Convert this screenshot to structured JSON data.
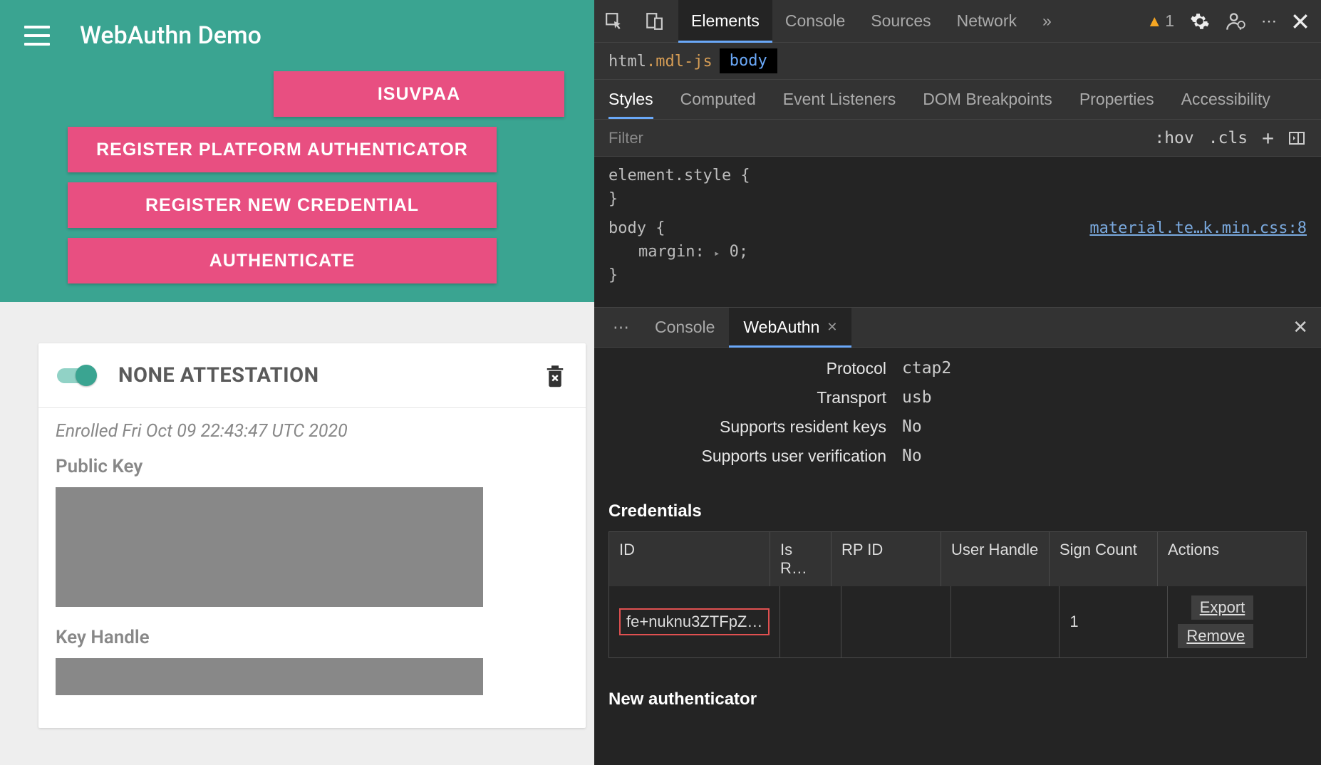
{
  "app": {
    "title": "WebAuthn Demo",
    "buttons": {
      "isuvpaa": "ISUVPAA",
      "reg_platform": "REGISTER PLATFORM AUTHENTICATOR",
      "reg_new": "REGISTER NEW CREDENTIAL",
      "auth": "AUTHENTICATE"
    },
    "card": {
      "title": "NONE ATTESTATION",
      "enrolled": "Enrolled Fri Oct 09 22:43:47 UTC 2020",
      "public_key_label": "Public Key",
      "key_handle_label": "Key Handle"
    }
  },
  "devtools": {
    "tabs": [
      "Elements",
      "Console",
      "Sources",
      "Network"
    ],
    "active_tab": "Elements",
    "warning_count": "1",
    "breadcrumb": {
      "html": "html",
      "class": ".mdl-js",
      "body": "body"
    },
    "styles_tabs": [
      "Styles",
      "Computed",
      "Event Listeners",
      "DOM Breakpoints",
      "Properties",
      "Accessibility"
    ],
    "active_styles_tab": "Styles",
    "filter_placeholder": "Filter",
    "filter_buttons": {
      "hov": ":hov",
      "cls": ".cls"
    },
    "css": {
      "element_style_open": "element.style {",
      "element_style_close": "}",
      "body_open": "body {",
      "body_prop": "margin: ▸ 0;",
      "body_prop_name": "margin",
      "body_prop_val": "0",
      "body_close": "}",
      "source_link": "material.te…k.min.css:8"
    },
    "drawer": {
      "tabs": [
        "Console",
        "WebAuthn"
      ],
      "active": "WebAuthn"
    },
    "auth": {
      "protocol_label": "Protocol",
      "protocol": "ctap2",
      "transport_label": "Transport",
      "transport": "usb",
      "resident_label": "Supports resident keys",
      "resident": "No",
      "uv_label": "Supports user verification",
      "uv": "No"
    },
    "credentials": {
      "title": "Credentials",
      "headers": {
        "id": "ID",
        "is": "Is R…",
        "rp": "RP ID",
        "uh": "User Handle",
        "sc": "Sign Count",
        "ac": "Actions"
      },
      "row": {
        "id": "fe+nuknu3ZTFpZ…",
        "is": "",
        "rp": "",
        "uh": "",
        "sc": "1"
      },
      "actions": {
        "export": "Export",
        "remove": "Remove"
      }
    },
    "new_auth_title": "New authenticator"
  }
}
